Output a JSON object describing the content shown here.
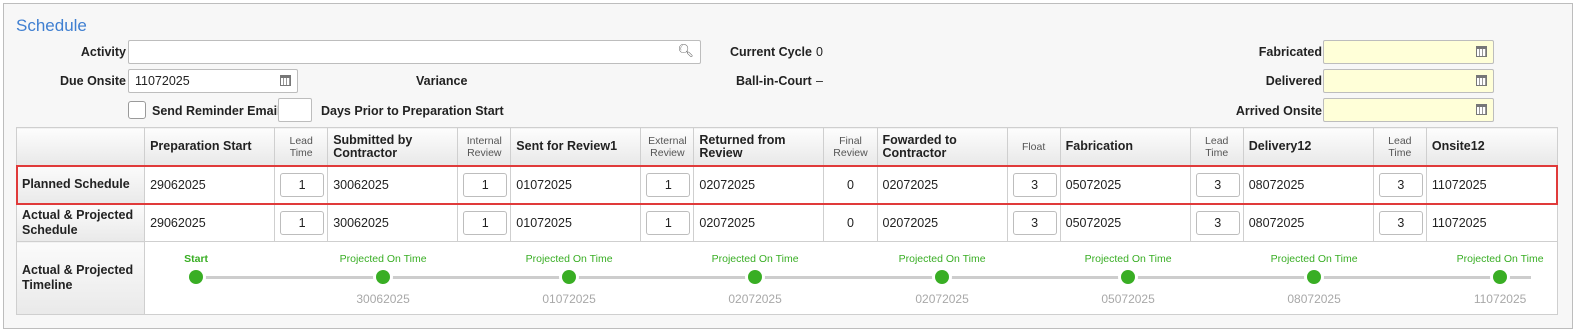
{
  "title": "Schedule",
  "fields": {
    "activity_label": "Activity",
    "activity_value": "",
    "due_onsite_label": "Due Onsite",
    "due_onsite_value": "11072025",
    "variance_label": "Variance",
    "current_cycle_label": "Current Cycle",
    "current_cycle_value": "0",
    "ball_in_court_label": "Ball-in-Court",
    "ball_in_court_value": "–",
    "send_reminder_label": "Send Reminder Email",
    "days_prior_value": "",
    "days_prior_label": "Days Prior to Preparation Start",
    "fabricated_label": "Fabricated",
    "delivered_label": "Delivered",
    "arrived_onsite_label": "Arrived Onsite"
  },
  "table": {
    "headers": [
      "",
      "Preparation Start",
      "Lead Time",
      "Submitted by Contractor",
      "Internal Review",
      "Sent for Review1",
      "External Review",
      "Returned from Review",
      "Final Review",
      "Fowarded to Contractor",
      "Float",
      "Fabrication",
      "Lead Time",
      "Delivery12",
      "Lead Time",
      "Onsite12"
    ],
    "planned": [
      "Planned Schedule",
      "29062025",
      "1",
      "30062025",
      "1",
      "01072025",
      "1",
      "02072025",
      "0",
      "02072025",
      "3",
      "05072025",
      "3",
      "08072025",
      "3",
      "11072025"
    ],
    "actual": [
      "Actual & Projected Schedule",
      "29062025",
      "1",
      "30062025",
      "1",
      "01072025",
      "1",
      "02072025",
      "0",
      "02072025",
      "3",
      "05072025",
      "3",
      "08072025",
      "3",
      "11072025"
    ],
    "timeline_label": "Actual & Projected Timeline"
  },
  "timeline": [
    {
      "status": "Start",
      "date": ""
    },
    {
      "status": "Projected On Time",
      "date": "30062025"
    },
    {
      "status": "Projected On Time",
      "date": "01072025"
    },
    {
      "status": "Projected On Time",
      "date": "02072025"
    },
    {
      "status": "Projected On Time",
      "date": "02072025"
    },
    {
      "status": "Projected On Time",
      "date": "05072025"
    },
    {
      "status": "Projected On Time",
      "date": "08072025"
    },
    {
      "status": "Projected On Time",
      "date": "11072025"
    }
  ],
  "colors": {
    "accent": "#3f7fd1",
    "status_green": "#39ae24",
    "highlight": "#e03a3a",
    "date_field_yellow": "#ffffd8"
  }
}
